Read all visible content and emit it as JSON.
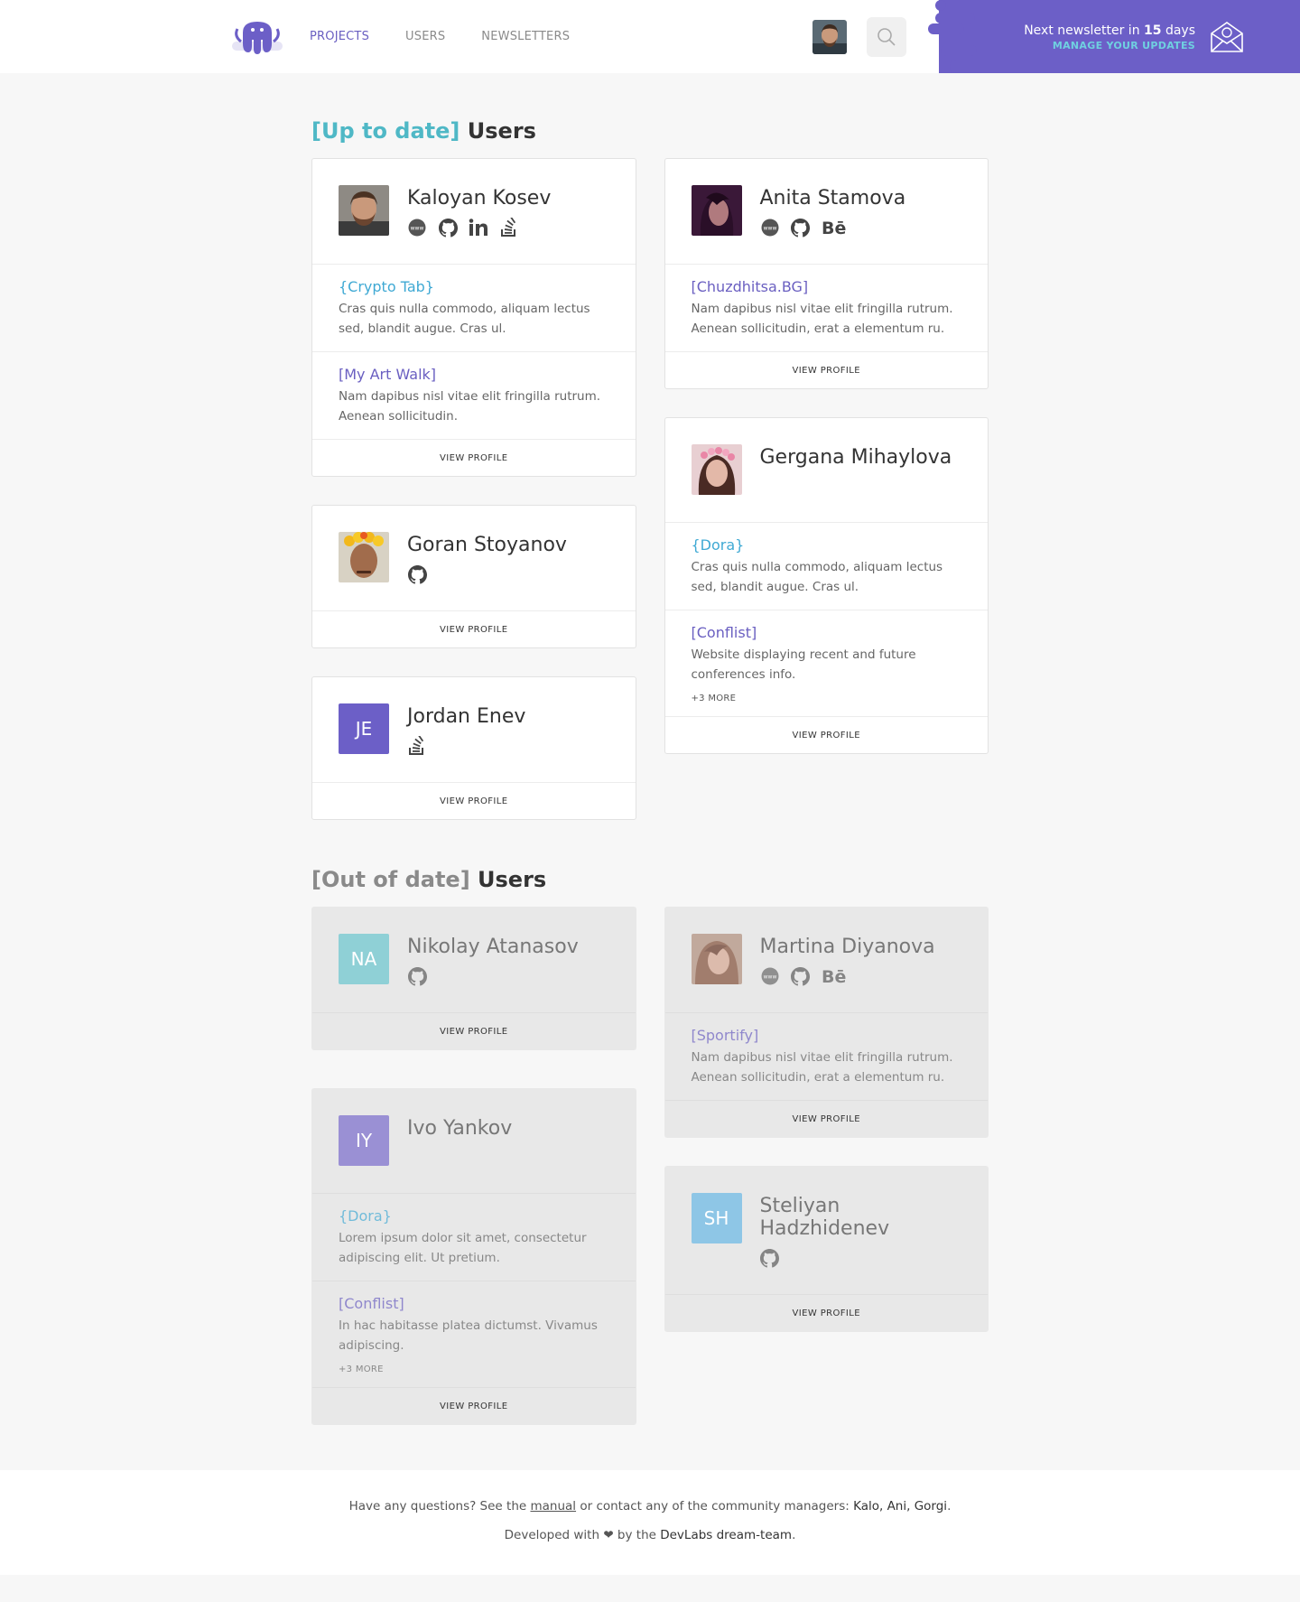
{
  "nav": {
    "items": [
      "PROJECTS",
      "USERS",
      "NEWSLETTERS"
    ],
    "active": "PROJECTS"
  },
  "newsletter": {
    "prefix": "Next newsletter in",
    "days": "15",
    "suffix": "days",
    "manage": "MANAGE YOUR UPDATES"
  },
  "colors": {
    "brand_purple": "#6c5fc7",
    "accent_cyan": "#4fb8c6",
    "link_cyan": "#3fa9d4"
  },
  "uptodate": {
    "bracket": "[Up to date]",
    "title": "Users"
  },
  "outdated": {
    "bracket": "[Out of date]",
    "title": "Users"
  },
  "users": {
    "kaloyan": {
      "name": "Kaloyan Kosev",
      "socials": [
        "www-icon",
        "github-icon",
        "linkedin-icon",
        "stackoverflow-icon"
      ],
      "projects": [
        {
          "name": "{Crypto Tab}",
          "desc": "Cras quis nulla commodo, aliquam lectus sed, blandit augue. Cras ul."
        },
        {
          "name": "[My Art Walk]",
          "desc": "Nam dapibus nisl vitae elit fringilla rutrum. Aenean sollicitudin."
        }
      ],
      "view": "VIEW PROFILE"
    },
    "goran": {
      "name": "Goran Stoyanov",
      "socials": [
        "github-icon"
      ],
      "view": "VIEW PROFILE"
    },
    "jordan": {
      "name": "Jordan Enev",
      "initials": "JE",
      "socials": [
        "stackoverflow-icon"
      ],
      "view": "VIEW PROFILE"
    },
    "anita": {
      "name": "Anita Stamova",
      "socials": [
        "www-icon",
        "github-icon",
        "behance-icon"
      ],
      "projects": [
        {
          "name": "[Chuzdhitsa.BG]",
          "desc": "Nam dapibus nisl vitae elit fringilla rutrum. Aenean sollicitudin, erat a elementum ru."
        }
      ],
      "view": "VIEW PROFILE"
    },
    "gergana": {
      "name": "Gergana Mihaylova",
      "projects": [
        {
          "name": "{Dora}",
          "desc": "Cras quis nulla commodo, aliquam lectus sed, blandit augue. Cras ul."
        },
        {
          "name": "[Conflist]",
          "desc": "Website displaying recent and future conferences info."
        }
      ],
      "more": "+3 MORE",
      "view": "VIEW PROFILE"
    },
    "nikolay": {
      "name": "Nikolay Atanasov",
      "initials": "NA",
      "socials": [
        "github-icon"
      ],
      "view": "VIEW PROFILE"
    },
    "ivo": {
      "name": "Ivo Yankov",
      "initials": "IY",
      "projects": [
        {
          "name": "{Dora}",
          "desc": "Lorem ipsum dolor sit amet, consectetur adipiscing elit. Ut pretium."
        },
        {
          "name": "[Conflist]",
          "desc": "In hac habitasse platea dictumst. Vivamus adipiscing."
        }
      ],
      "more": "+3 MORE",
      "view": "VIEW PROFILE"
    },
    "martina": {
      "name": "Martina Diyanova",
      "socials": [
        "www-icon",
        "github-icon",
        "behance-icon"
      ],
      "projects": [
        {
          "name": "[Sportify]",
          "desc": "Nam dapibus nisl vitae elit fringilla rutrum. Aenean sollicitudin, erat a elementum ru."
        }
      ],
      "view": "VIEW PROFILE"
    },
    "steliyan": {
      "name": "Steliyan Hadzhidenev",
      "initials": "SH",
      "socials": [
        "github-icon"
      ],
      "view": "VIEW PROFILE"
    }
  },
  "footer": {
    "q_prefix": "Have any questions? See the",
    "manual": "manual",
    "q_middle": "or contact any of the community managers:",
    "managers": "Kalo, Ani, Gorgi",
    "q_end": ".",
    "dev_prefix": "Developed with",
    "heart": "❤",
    "dev_middle": "by the",
    "team": "DevLabs dream-team",
    "dev_end": "."
  }
}
